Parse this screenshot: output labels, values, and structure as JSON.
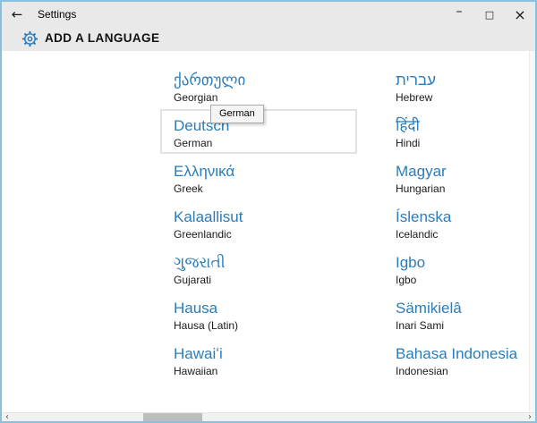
{
  "window": {
    "title": "Settings",
    "back_icon": "←",
    "controls": {
      "minimize": "–",
      "maximize": "□",
      "close": "×"
    }
  },
  "header": {
    "title": "ADD A LANGUAGE"
  },
  "tooltip": {
    "text": "German"
  },
  "languages": {
    "columns": [
      {
        "items": [
          {
            "native": "ქართული",
            "english": "Georgian",
            "hovered": false
          },
          {
            "native": "Deutsch",
            "english": "German",
            "hovered": true
          },
          {
            "native": "Ελληνικά",
            "english": "Greek",
            "hovered": false
          },
          {
            "native": "Kalaallisut",
            "english": "Greenlandic",
            "hovered": false
          },
          {
            "native": "ગુજરાતી",
            "english": "Gujarati",
            "hovered": false
          },
          {
            "native": "Hausa",
            "english": "Hausa (Latin)",
            "hovered": false
          },
          {
            "native": "Hawaiʻi",
            "english": "Hawaiian",
            "hovered": false
          }
        ]
      },
      {
        "items": [
          {
            "native": "עברית",
            "english": "Hebrew",
            "hovered": false
          },
          {
            "native": "हिंदी",
            "english": "Hindi",
            "hovered": false
          },
          {
            "native": "Magyar",
            "english": "Hungarian",
            "hovered": false
          },
          {
            "native": "Íslenska",
            "english": "Icelandic",
            "hovered": false
          },
          {
            "native": "Igbo",
            "english": "Igbo",
            "hovered": false
          },
          {
            "native": "Sämikielâ",
            "english": "Inari Sami",
            "hovered": false
          },
          {
            "native": "Bahasa Indonesia",
            "english": "Indonesian",
            "hovered": false
          }
        ]
      }
    ]
  },
  "scrollbar": {
    "left_arrow": "‹",
    "right_arrow": "›"
  },
  "colors": {
    "accent_blue": "#2b7cb8",
    "window_border": "#89c0de",
    "titlebar_bg": "#e9e9e9",
    "tooltip_bg": "#f5f5f5",
    "hover_border": "#e2e2e2",
    "scroll_thumb": "#bdbdbd"
  }
}
